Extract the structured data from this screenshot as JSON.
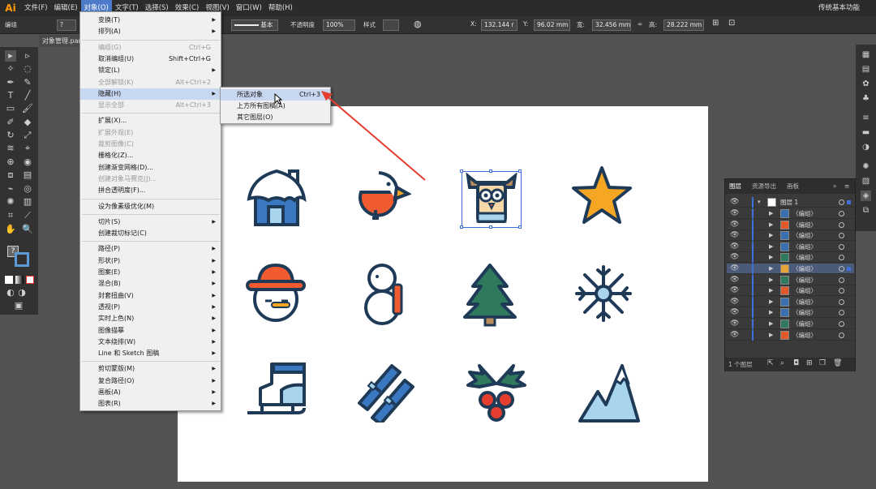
{
  "app": {
    "logo": "Ai",
    "workspace": "传统基本功能"
  },
  "menubar": [
    "文件(F)",
    "编辑(E)",
    "对象(O)",
    "文字(T)",
    "选择(S)",
    "效果(C)",
    "视图(V)",
    "窗口(W)",
    "帮助(H)"
  ],
  "controlbar": {
    "left_label": "编组",
    "stroke_style": "基本",
    "opacity_label": "不透明度",
    "opacity_value": "100%",
    "style_label": "样式",
    "x_label": "X:",
    "x_value": "132.144 r",
    "y_label": "Y:",
    "y_value": "96.02 mm",
    "w_label": "宽:",
    "w_value": "32.456 mm",
    "h_label": "高:",
    "h_value": "28.222 mm"
  },
  "document_tab": "对象管理.par",
  "object_menu": [
    {
      "label": "变换(T)",
      "shortcut": "",
      "submenu": true,
      "disabled": false
    },
    {
      "label": "排列(A)",
      "shortcut": "",
      "submenu": true,
      "disabled": false
    },
    {
      "sep": true
    },
    {
      "label": "编组(G)",
      "shortcut": "Ctrl+G",
      "submenu": false,
      "disabled": true
    },
    {
      "label": "取消编组(U)",
      "shortcut": "Shift+Ctrl+G",
      "submenu": false,
      "disabled": false
    },
    {
      "label": "锁定(L)",
      "shortcut": "",
      "submenu": true,
      "disabled": false
    },
    {
      "label": "全部解锁(K)",
      "shortcut": "Alt+Ctrl+2",
      "submenu": false,
      "disabled": true
    },
    {
      "label": "隐藏(H)",
      "shortcut": "",
      "submenu": true,
      "disabled": false,
      "highlight": true
    },
    {
      "label": "显示全部",
      "shortcut": "Alt+Ctrl+3",
      "submenu": false,
      "disabled": true
    },
    {
      "sep": true
    },
    {
      "label": "扩展(X)...",
      "shortcut": "",
      "submenu": false,
      "disabled": false
    },
    {
      "label": "扩展外观(E)",
      "shortcut": "",
      "submenu": false,
      "disabled": true
    },
    {
      "label": "裁剪图像(C)",
      "shortcut": "",
      "submenu": false,
      "disabled": true
    },
    {
      "label": "栅格化(Z)...",
      "shortcut": "",
      "submenu": false,
      "disabled": false
    },
    {
      "label": "创建渐变网格(D)...",
      "shortcut": "",
      "submenu": false,
      "disabled": false
    },
    {
      "label": "创建对象马赛克(J)...",
      "shortcut": "",
      "submenu": false,
      "disabled": true
    },
    {
      "label": "拼合透明度(F)...",
      "shortcut": "",
      "submenu": false,
      "disabled": false
    },
    {
      "sep": true
    },
    {
      "label": "设为像素级优化(M)",
      "shortcut": "",
      "submenu": false,
      "disabled": false
    },
    {
      "sep": true
    },
    {
      "label": "切片(S)",
      "shortcut": "",
      "submenu": true,
      "disabled": false
    },
    {
      "label": "创建裁切标记(C)",
      "shortcut": "",
      "submenu": false,
      "disabled": false
    },
    {
      "sep": true
    },
    {
      "label": "路径(P)",
      "shortcut": "",
      "submenu": true,
      "disabled": false
    },
    {
      "label": "形状(P)",
      "shortcut": "",
      "submenu": true,
      "disabled": false
    },
    {
      "label": "图案(E)",
      "shortcut": "",
      "submenu": true,
      "disabled": false
    },
    {
      "label": "混合(B)",
      "shortcut": "",
      "submenu": true,
      "disabled": false
    },
    {
      "label": "封套扭曲(V)",
      "shortcut": "",
      "submenu": true,
      "disabled": false
    },
    {
      "label": "透视(P)",
      "shortcut": "",
      "submenu": true,
      "disabled": false
    },
    {
      "label": "实时上色(N)",
      "shortcut": "",
      "submenu": true,
      "disabled": false
    },
    {
      "label": "图像描摹",
      "shortcut": "",
      "submenu": true,
      "disabled": false
    },
    {
      "label": "文本绕排(W)",
      "shortcut": "",
      "submenu": true,
      "disabled": false
    },
    {
      "label": "Line 和 Sketch 图稿",
      "shortcut": "",
      "submenu": true,
      "disabled": false
    },
    {
      "sep": true
    },
    {
      "label": "剪切蒙版(M)",
      "shortcut": "",
      "submenu": true,
      "disabled": false
    },
    {
      "label": "复合路径(O)",
      "shortcut": "",
      "submenu": true,
      "disabled": false
    },
    {
      "label": "画板(A)",
      "shortcut": "",
      "submenu": true,
      "disabled": false
    },
    {
      "label": "图表(R)",
      "shortcut": "",
      "submenu": true,
      "disabled": false
    }
  ],
  "hide_submenu": [
    {
      "label": "所选对象",
      "shortcut": "Ctrl+3",
      "highlight": true
    },
    {
      "label": "上方所有图稿(A)",
      "shortcut": ""
    },
    {
      "label": "其它图层(O)",
      "shortcut": ""
    }
  ],
  "layers_panel": {
    "tabs": [
      "图层",
      "资源导出",
      "画板"
    ],
    "top_layer": "图层 1",
    "group_label": "〈编组〉",
    "group_count": 12,
    "selected_index": 5,
    "thumb_colors": [
      "#3a6fb0",
      "#e05a2a",
      "#3a6fb0",
      "#3a6fb0",
      "#2f7a5c",
      "#e8a33a",
      "#2f7a5c",
      "#e05a2a",
      "#3a6fb0",
      "#3a6fb0",
      "#2f7a5c",
      "#e05a2a"
    ],
    "footer_count": "1 个图层"
  },
  "colors": {
    "accent": "#4d7ac9",
    "navy": "#1f3a57",
    "blue": "#3b78c2",
    "lightblue": "#a8d4ee",
    "orange": "#ef5a2f",
    "yellow": "#f5a623",
    "green": "#2f7a5c",
    "red": "#e53d2f"
  }
}
